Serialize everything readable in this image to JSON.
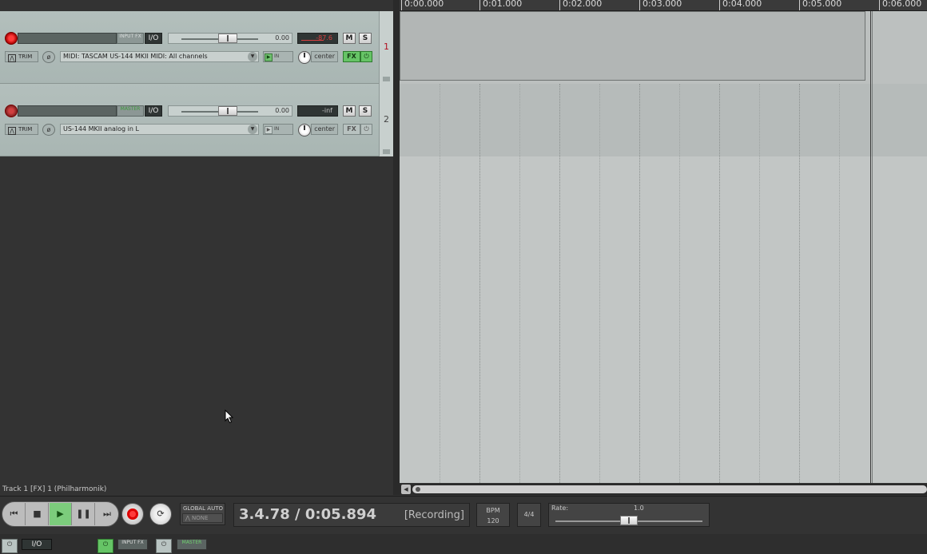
{
  "ruler": {
    "labels": [
      "0:00.000",
      "0:01.000",
      "0:02.000",
      "0:03.000",
      "0:04.000",
      "0:05.000",
      "0:06.000"
    ]
  },
  "tracks": [
    {
      "number": "1",
      "name_label": "INPUT FX",
      "io_label": "I/O",
      "volume": "0.00",
      "meter": "-87.6",
      "mute_label": "M",
      "solo_label": "S",
      "trim_label": "TRIM",
      "input": "MIDI: TASCAM US-144 MKII MIDI: All channels",
      "monitor_label": "IN",
      "pan_label": "center",
      "fx_label": "FX",
      "selected": true
    },
    {
      "number": "2",
      "name_label": "MASTER",
      "io_label": "I/O",
      "volume": "0.00",
      "meter": "-inf",
      "mute_label": "M",
      "solo_label": "S",
      "trim_label": "TRIM",
      "input": "US-144 MKII analog in L",
      "monitor_label": "IN",
      "pan_label": "center",
      "fx_label": "FX",
      "selected": false
    }
  ],
  "status_line": "Track 1 [FX] 1 (Philharmonik)",
  "transport": {
    "global_auto_label": "GLOBAL AUTO",
    "global_auto_value": "NONE",
    "position": "3.4.78 / 0:05.894",
    "state": "[Recording]",
    "bpm_label": "BPM",
    "bpm_value": "120",
    "time_signature": "4/4",
    "rate_label": "Rate:",
    "rate_value": "1.0",
    "rate_level": 0.5
  },
  "bottom_bar": {
    "io_label": "I/O",
    "inputfx_label": "INPUT FX",
    "master_label": "MASTER"
  }
}
